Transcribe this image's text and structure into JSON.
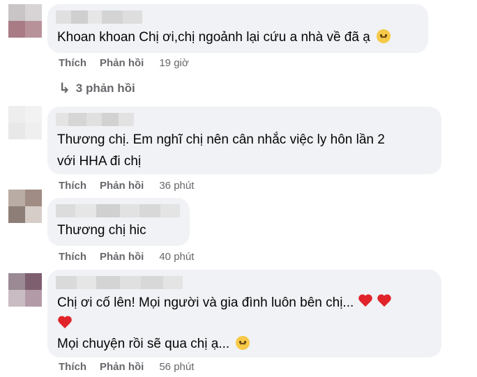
{
  "comments": [
    {
      "text_lines": [
        "Khoan khoan Chị ơi,chị ngoảnh lại cứu a nhà về đã ạ"
      ],
      "emoji": "sad-face",
      "like_label": "Thích",
      "reply_label": "Phản hồi",
      "time": "19 giờ"
    },
    {
      "text_lines": [
        "Thương chị. Em nghĩ chị nên cân nhắc việc ly hôn lần 2",
        "với HHA đi chị"
      ],
      "like_label": "Thích",
      "reply_label": "Phản hồi",
      "time": "36 phút"
    },
    {
      "text_lines": [
        "Thương chị hic"
      ],
      "like_label": "Thích",
      "reply_label": "Phản hồi",
      "time": "40 phút"
    },
    {
      "text_lines": [
        "Chị ơi cố lên! Mọi người và gia đình luôn bên chị...",
        "",
        "Mọi chuyện rồi sẽ qua chị ạ..."
      ],
      "emoji": "heart",
      "emoji_end": "pensive-face",
      "like_label": "Thích",
      "reply_label": "Phản hồi",
      "time": "56 phút"
    }
  ],
  "replies_link": "3 phản hồi",
  "colors": {
    "bubble": "#f0f2f5",
    "meta": "#65676b",
    "text": "#050505",
    "heart": "#e0242a"
  }
}
